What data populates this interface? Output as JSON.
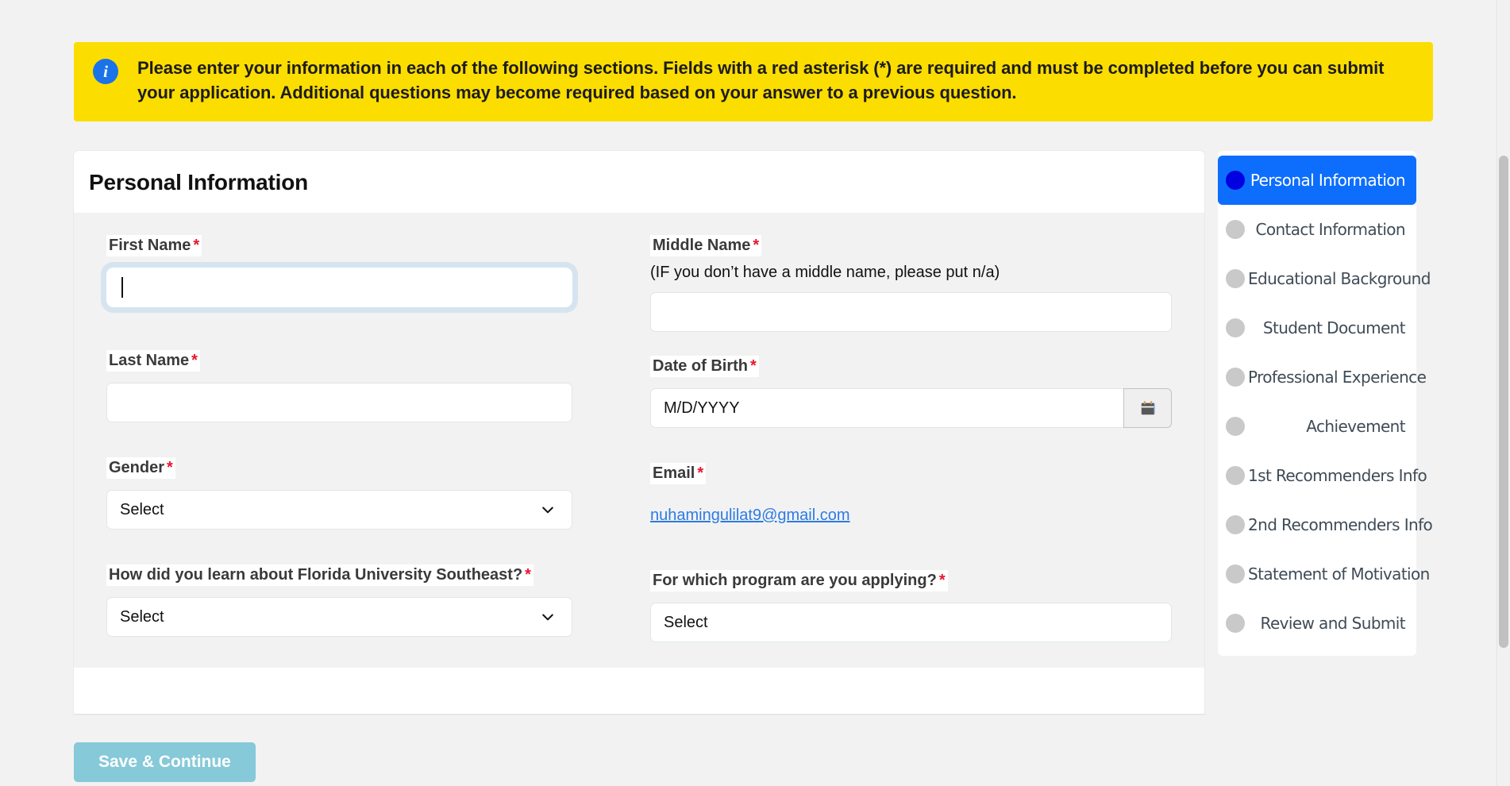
{
  "banner": {
    "icon": "info-icon",
    "text": "Please enter your information in each of the following sections. Fields with a red asterisk (*) are required and must be completed before you can submit your application. Additional questions may become required based on your answer to a previous question.",
    "background_color": "#fcdd00",
    "icon_color": "#1a73e8"
  },
  "card": {
    "title": "Personal Information"
  },
  "fields": {
    "first_name": {
      "label": "First Name",
      "required_marker": "*",
      "value": "",
      "focused": true
    },
    "middle_name": {
      "label": "Middle Name",
      "required_marker": "*",
      "hint": "(IF you don’t have a middle name, please put n/a)",
      "value": ""
    },
    "last_name": {
      "label": "Last Name",
      "required_marker": "*",
      "value": ""
    },
    "date_of_birth": {
      "label": "Date of Birth",
      "required_marker": "*",
      "placeholder": "M/D/YYYY",
      "value": "",
      "button_icon": "calendar-icon"
    },
    "gender": {
      "label": "Gender",
      "required_marker": "*",
      "selected": "Select"
    },
    "email": {
      "label": "Email",
      "required_marker": "*",
      "value": "nuhamingulilat9@gmail.com",
      "link_color": "#2c7be5"
    },
    "referral_source": {
      "label": "How did you learn about Florida University Southeast?",
      "required_marker": "*",
      "selected": "Select"
    },
    "program": {
      "label": "For which program are you applying?",
      "required_marker": "*",
      "selected": "Select"
    }
  },
  "actions": {
    "save_continue": "Save & Continue",
    "save_continue_color": "#86c9d9"
  },
  "stepper": {
    "active_color": "#0d6efd",
    "active_dot_color": "#0000e0",
    "inactive_dot_color": "#c9c9c9",
    "items": [
      {
        "label": "Personal Information",
        "active": true
      },
      {
        "label": "Contact Information",
        "active": false
      },
      {
        "label": "Educational Background",
        "active": false
      },
      {
        "label": "Student Document",
        "active": false
      },
      {
        "label": "Professional Experience",
        "active": false
      },
      {
        "label": "Achievement",
        "active": false
      },
      {
        "label": "1st Recommenders Info",
        "active": false
      },
      {
        "label": "2nd Recommenders Info",
        "active": false
      },
      {
        "label": "Statement of Motivation",
        "active": false
      },
      {
        "label": "Review and Submit",
        "active": false
      }
    ]
  }
}
